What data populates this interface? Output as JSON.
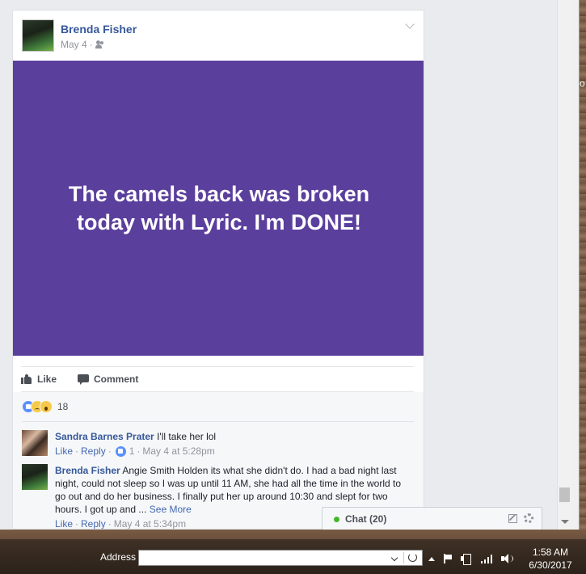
{
  "post": {
    "author": "Brenda Fisher",
    "date": "May 4",
    "date_sep": "·",
    "status_text": "The camels back was broken today with Lyric. I'm DONE!",
    "status_bg_color": "#5b3f9c",
    "actions": {
      "like_label": "Like",
      "comment_label": "Comment"
    },
    "reactions": {
      "types": [
        "like",
        "sad",
        "wow"
      ],
      "count": "18"
    },
    "comments": [
      {
        "author": "Sandra Barnes Prater",
        "text": "I'll take her lol",
        "like_label": "Like",
        "reply_label": "Reply",
        "like_count": "1",
        "timestamp": "May 4 at 5:28pm"
      },
      {
        "author": "Brenda Fisher",
        "text": "Angie Smith Holden its what she didn't do. I had a bad night last night, could not sleep so I was up until 11 AM, she had all the time in the world to go out and do her business. I finally put her up around 10:30 and slept for two hours. I got up and ...",
        "see_more": "See More",
        "like_label": "Like",
        "reply_label": "Reply",
        "timestamp": "May 4 at 5:34pm"
      }
    ]
  },
  "chat": {
    "label": "Chat (20)",
    "status_color": "#42b72a"
  },
  "right_edge_fragment": "o",
  "taskbar": {
    "address_label": "Address",
    "address_value": "",
    "time": "1:58 AM",
    "date": "6/30/2017"
  },
  "colors": {
    "link": "#365899",
    "page_bg": "#e9ebee"
  }
}
